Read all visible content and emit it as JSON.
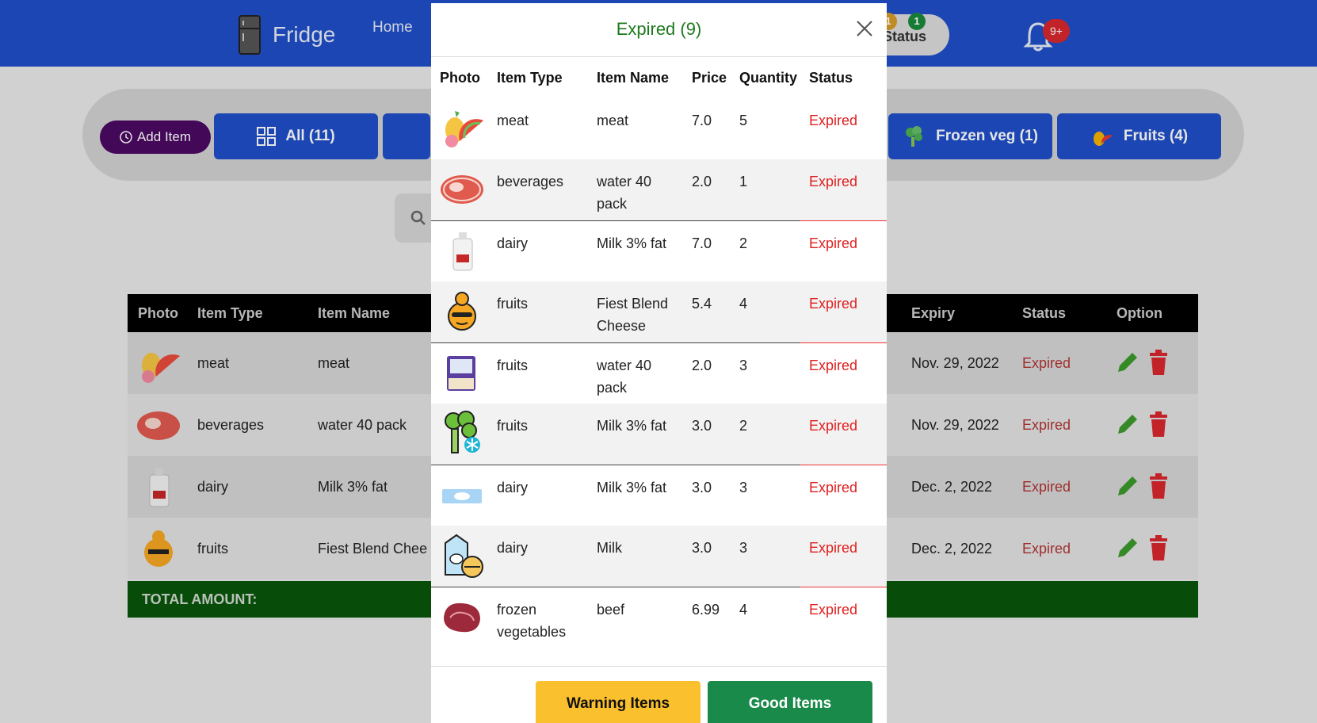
{
  "header": {
    "brand": "Fridge",
    "nav_home": "Home",
    "status_label": "Status",
    "status_warning_count": "1",
    "status_good_count": "1",
    "notification_badge": "9+"
  },
  "filters": {
    "add_item": "Add Item",
    "all": "All (11)",
    "frozen_veg": "Frozen veg (1)",
    "fruits": "Fruits (4)"
  },
  "background_table": {
    "headers": [
      "Photo",
      "Item Type",
      "Item Name",
      "Expiry",
      "Status",
      "Option"
    ],
    "rows": [
      {
        "type": "meat",
        "name": "meat",
        "expiry": "Nov. 29, 2022",
        "status": "Expired"
      },
      {
        "type": "beverages",
        "name": "water 40 pack",
        "expiry": "Nov. 29, 2022",
        "status": "Expired"
      },
      {
        "type": "dairy",
        "name": "Milk 3% fat",
        "expiry": "Dec. 2, 2022",
        "status": "Expired"
      },
      {
        "type": "fruits",
        "name": "Fiest Blend Chee",
        "expiry": "Dec. 2, 2022",
        "status": "Expired"
      }
    ],
    "total_label": "TOTAL AMOUNT:"
  },
  "modal": {
    "title": "Expired (9)",
    "headers": [
      "Photo",
      "Item Type",
      "Item Name",
      "Price",
      "Quantity",
      "Status"
    ],
    "rows": [
      {
        "photo": "fruit-basket-icon",
        "type": "meat",
        "name": "meat",
        "price": "7.0",
        "qty": "5",
        "status": "Expired"
      },
      {
        "photo": "steak-icon",
        "type": "beverages",
        "name": "water 40 pack",
        "price": "2.0",
        "qty": "1",
        "status": "Expired"
      },
      {
        "photo": "milk-jug-icon",
        "type": "dairy",
        "name": "Milk 3% fat",
        "price": "7.0",
        "qty": "2",
        "status": "Expired"
      },
      {
        "photo": "cheese-character-icon",
        "type": "fruits",
        "name": "Fiest Blend Cheese",
        "price": "5.4",
        "qty": "4",
        "status": "Expired"
      },
      {
        "photo": "water-pack-icon",
        "type": "fruits",
        "name": "water 40 pack",
        "price": "2.0",
        "qty": "3",
        "status": "Expired"
      },
      {
        "photo": "frozen-broccoli-icon",
        "type": "fruits",
        "name": "Milk 3% fat",
        "price": "3.0",
        "qty": "2",
        "status": "Expired"
      },
      {
        "photo": "milk-carton-icon",
        "type": "dairy",
        "name": "Milk 3% fat",
        "price": "3.0",
        "qty": "3",
        "status": "Expired"
      },
      {
        "photo": "dairy-products-icon",
        "type": "dairy",
        "name": "Milk",
        "price": "3.0",
        "qty": "3",
        "status": "Expired"
      },
      {
        "photo": "raw-beef-icon",
        "type": "frozen vegetables",
        "name": "beef",
        "price": "6.99",
        "qty": "4",
        "status": "Expired"
      }
    ],
    "warning_button": "Warning Items",
    "good_button": "Good Items"
  },
  "colors": {
    "header_blue": "#1f4fc9",
    "add_item_purple": "#4b0a63",
    "expired_red": "#e01f1f",
    "title_green": "#1e7a1e",
    "warning_yellow": "#fbc02d",
    "good_green": "#1a8a4a",
    "total_green": "#08550a"
  }
}
